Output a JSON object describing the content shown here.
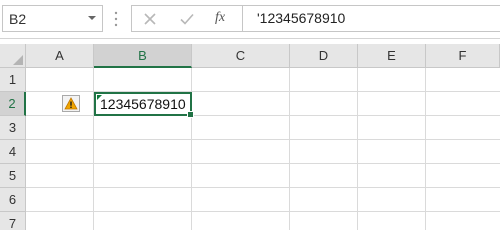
{
  "name_box": {
    "value": "B2"
  },
  "formula_bar": {
    "cancel_icon": "x-icon",
    "enter_icon": "checkmark-icon",
    "function_icon": "fx-icon",
    "fx_label": "fx",
    "content": "'12345678910"
  },
  "columns": [
    "A",
    "B",
    "C",
    "D",
    "E",
    "F"
  ],
  "rows": [
    "1",
    "2",
    "3",
    "4",
    "5",
    "6",
    "7"
  ],
  "selected_cell": {
    "column": "B",
    "row": "2",
    "value": "12345678910"
  },
  "error_indicator": {
    "icon": "warning-icon"
  },
  "colors": {
    "accent": "#217346",
    "header_bg": "#e6e6e6",
    "gridline": "#dadada",
    "warning": "#f0a500"
  }
}
